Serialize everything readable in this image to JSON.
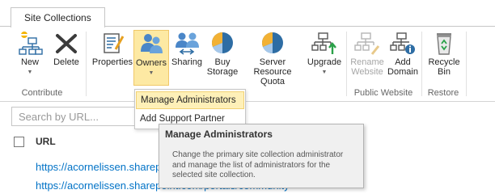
{
  "ribbon": {
    "tab_label": "Site Collections",
    "groups": {
      "contribute": "Contribute",
      "public_website": "Public Website",
      "restore": "Restore"
    },
    "buttons": {
      "new": "New",
      "delete": "Delete",
      "properties": "Properties",
      "owners": "Owners",
      "sharing": "Sharing",
      "buy_storage_1": "Buy",
      "buy_storage_2": "Storage",
      "server_quota_1": "Server Resource",
      "server_quota_2": "Quota",
      "upgrade": "Upgrade",
      "rename_1": "Rename",
      "rename_2": "Website",
      "add_domain_1": "Add",
      "add_domain_2": "Domain",
      "recycle_1": "Recycle",
      "recycle_2": "Bin"
    }
  },
  "owners_menu": {
    "items": [
      "Manage Administrators",
      "Add Support Partner"
    ]
  },
  "tooltip": {
    "title": "Manage Administrators",
    "description": "Change the primary site collection administrator and manage the list of administrators for the selected site collection."
  },
  "list": {
    "search_placeholder": "Search by URL...",
    "column_url": "URL",
    "rows": [
      "https://acornelissen.sharepoint.com",
      "https://acornelissen.sharepoint.com/portals/community"
    ]
  },
  "colors": {
    "accent": "#0072c6",
    "active": "#fde9a3"
  }
}
